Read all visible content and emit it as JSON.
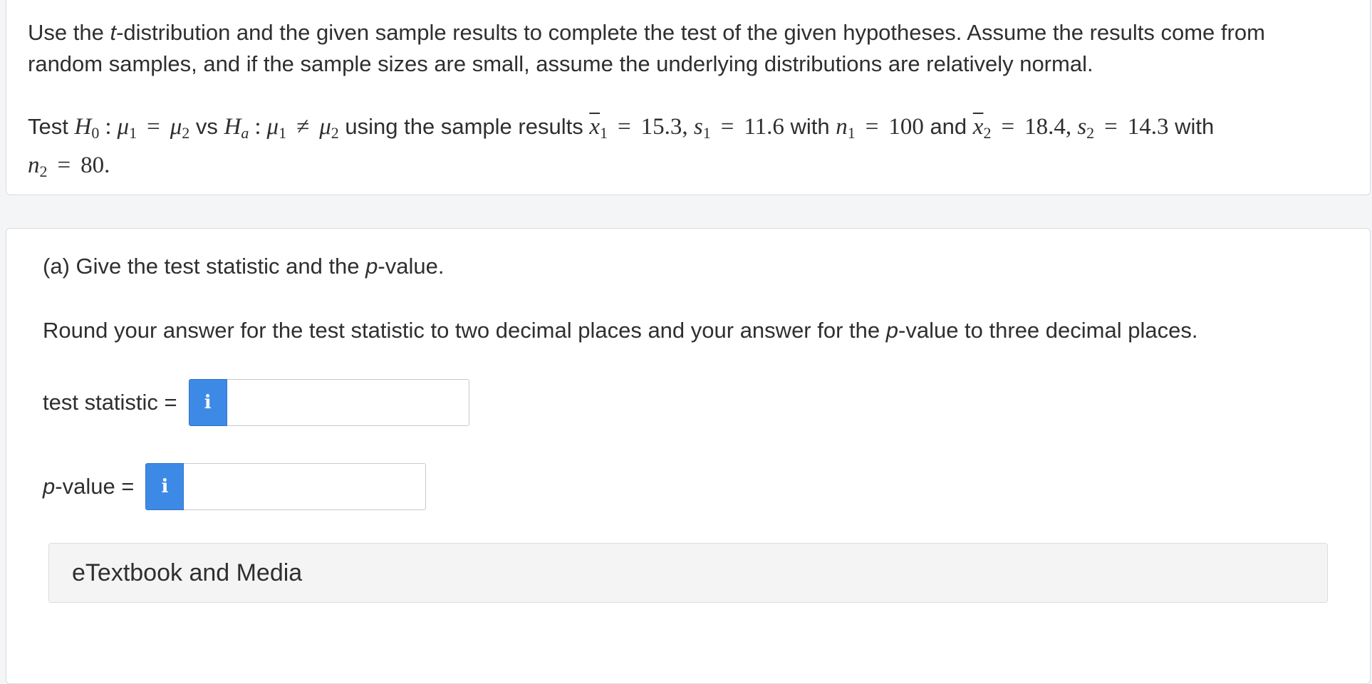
{
  "question": {
    "intro_1": "Use the ",
    "intro_t": "t",
    "intro_2": "-distribution and the given sample results to complete the test of the given hypotheses. Assume the results come from random samples, and if the sample sizes are small, assume the underlying distributions are relatively normal.",
    "test_prefix": "Test ",
    "h0": "H",
    "h0_sub": "0",
    "colon": ":",
    "mu": "μ",
    "sub_1": "1",
    "sub_2": "2",
    "eq": "=",
    "neq": "≠",
    "vs": " vs ",
    "ha": "H",
    "ha_sub": "a",
    "using": " using the sample results ",
    "x": "x",
    "s": "s",
    "n": "n",
    "xbar1": "15.3",
    "s1": "11.6",
    "with_1": " with ",
    "n1": "100",
    "and": " and ",
    "xbar2": "18.4",
    "s2": "14.3",
    "with_2": " with",
    "n2": "80.",
    "comma": ", "
  },
  "part_a": {
    "title_1": "(a) Give the test statistic and the ",
    "title_p": "p",
    "title_2": "-value.",
    "instr_1": "Round your answer for the test statistic to two decimal places and your answer for the ",
    "instr_p": "p",
    "instr_2": "-value to three decimal places.",
    "stat_label": "test statistic =",
    "pval_label_p": "p",
    "pval_label_rest": "-value =",
    "info_glyph": "i",
    "stat_value": "",
    "pval_value": ""
  },
  "media": {
    "label": "eTextbook and Media"
  },
  "colors": {
    "accent": "#3d8ae6",
    "card_border": "#d9dcdf",
    "background": "#f4f5f7"
  }
}
